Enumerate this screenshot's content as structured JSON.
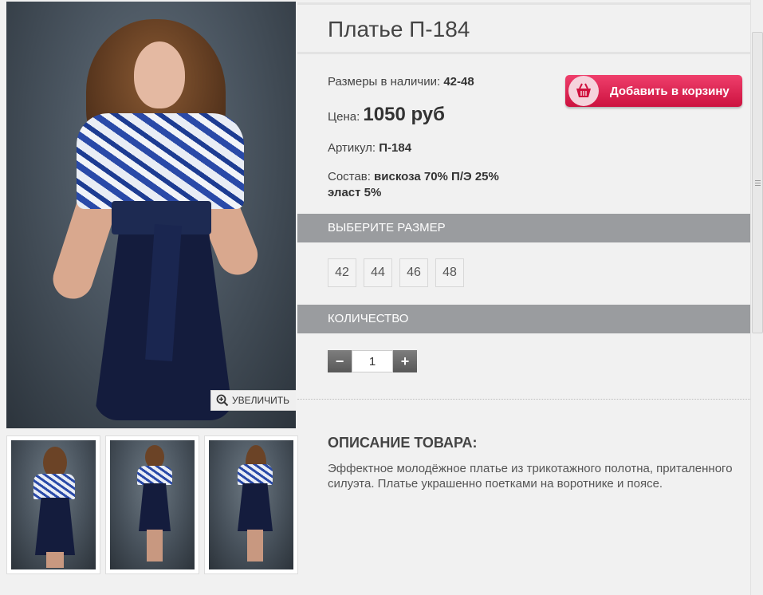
{
  "product": {
    "title": "Платье П-184",
    "sizes_label": "Размеры в наличии:",
    "sizes_value": "42-48",
    "price_label": "Цена:",
    "price_value": "1050 руб",
    "sku_label": "Артикул:",
    "sku_value": "П-184",
    "composition_label": "Состав:",
    "composition_line1": "вискоза 70% П/Э 25%",
    "composition_line2": "эласт 5%"
  },
  "cart_button": {
    "label": "Добавить в корзину",
    "color": "#e0244f"
  },
  "gallery": {
    "zoom_label": "УВЕЛИЧИТЬ",
    "thumbnail_count": 3
  },
  "size_section": {
    "header": "ВЫБЕРИТЕ РАЗМЕР",
    "options": [
      "42",
      "44",
      "46",
      "48"
    ]
  },
  "quantity_section": {
    "header": "КОЛИЧЕСТВО",
    "minus": "−",
    "plus": "+",
    "value": "1"
  },
  "description": {
    "title": "ОПИСАНИЕ ТОВАРА:",
    "text": "Эффектное молодёжное платье из трикотажного полотна, приталенного силуэта. Платье украшенно поетками на воротнике и поясе."
  }
}
